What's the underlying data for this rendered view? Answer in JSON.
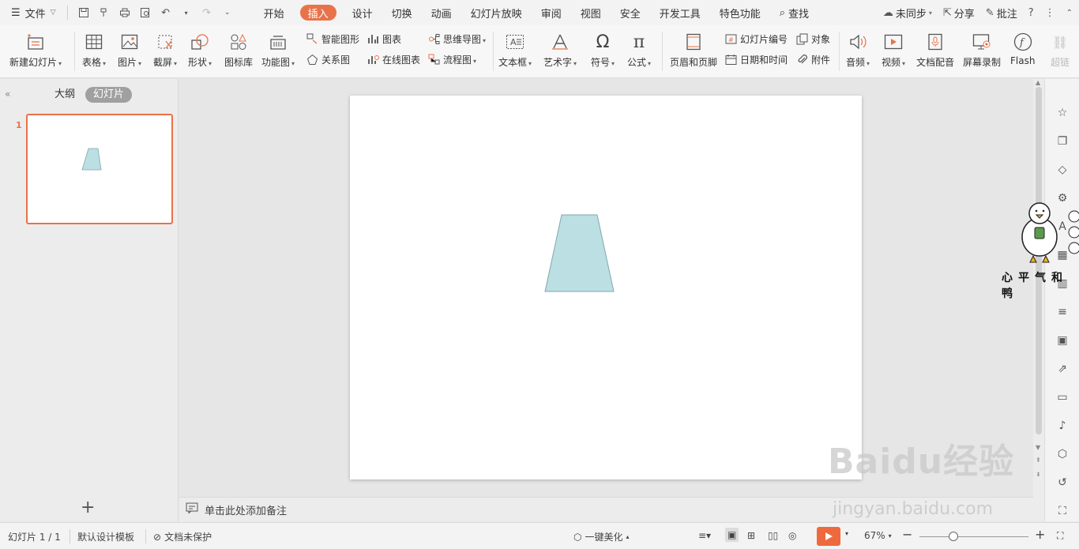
{
  "menubar": {
    "file_label": "文件",
    "tabs": [
      "开始",
      "插入",
      "设计",
      "切换",
      "动画",
      "幻灯片放映",
      "审阅",
      "视图",
      "安全",
      "开发工具",
      "特色功能"
    ],
    "active_tab": "插入",
    "search_label": "查找",
    "sync_label": "未同步",
    "share_label": "分享",
    "comment_label": "批注",
    "help_label": "?"
  },
  "ribbon": {
    "new_slide": "新建幻灯片",
    "table": "表格",
    "picture": "图片",
    "screenshot": "截屏",
    "shape": "形状",
    "icon_lib": "图标库",
    "function_chart": "功能图",
    "smart_shape": "智能图形",
    "chart": "图表",
    "relation_chart": "关系图",
    "online_chart": "在线图表",
    "mind_map": "思维导图",
    "flow_chart": "流程图",
    "text_box": "文本框",
    "art_text": "艺术字",
    "symbol": "符号",
    "formula": "公式",
    "header_footer": "页眉和页脚",
    "slide_number": "幻灯片编号",
    "object": "对象",
    "date_time": "日期和时间",
    "attachment": "附件",
    "audio": "音频",
    "video": "视频",
    "doc_dub": "文档配音",
    "screen_record": "屏幕录制",
    "flash": "Flash",
    "hyperlink": "超链"
  },
  "leftpanel": {
    "outline_tab": "大纲",
    "slides_tab": "幻灯片",
    "slide_number": "1",
    "add_symbol": "+"
  },
  "notes": {
    "placeholder": "单击此处添加备注"
  },
  "statusbar": {
    "slide_info": "幻灯片 1 / 1",
    "template": "默认设计模板",
    "protection": "文档未保护",
    "beautify": "一键美化",
    "zoom": "67%"
  },
  "slide": {
    "shape_fill": "#bbdfe2",
    "shape_stroke": "#7fa9ad"
  },
  "watermark": {
    "brand": "Baidu经验",
    "url": "jingyan.baidu.com",
    "duck_caption": "心平气和鸭"
  },
  "colors": {
    "accent": "#e8734a",
    "play": "#ee6a3c"
  }
}
